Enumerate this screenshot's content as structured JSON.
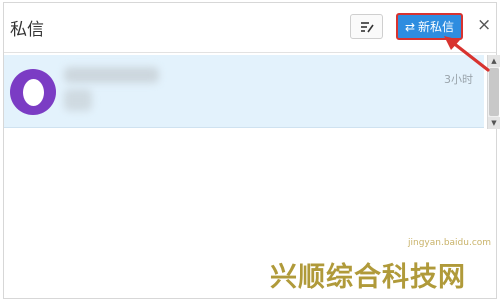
{
  "header": {
    "title": "私信",
    "compose_icon": "compose-icon",
    "new_message_label": "新私信",
    "new_message_icon": "swap-icon",
    "close_label": "×"
  },
  "conversations": [
    {
      "time": "3小时",
      "avatar_color": "#7b3cc4",
      "selected": true
    }
  ],
  "scrollbar": {
    "up": "▲",
    "down": "▼"
  },
  "annotation": {
    "arrow_color": "#d8332f"
  },
  "watermark": {
    "main": "兴顺综合科技网",
    "sub": "jingyan.baidu.com"
  }
}
